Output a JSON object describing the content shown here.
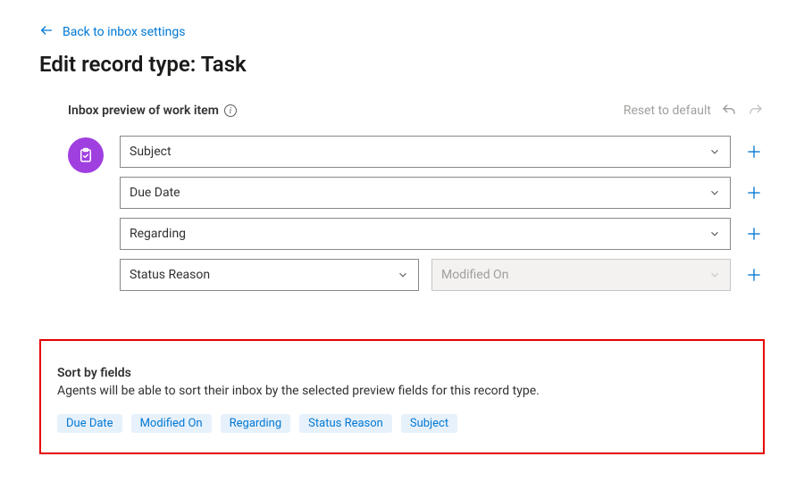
{
  "back_link": {
    "label": "Back to inbox settings"
  },
  "page_title": "Edit record type: Task",
  "preview": {
    "section_label": "Inbox preview of work item",
    "reset_label": "Reset to default",
    "rows": [
      {
        "fields": [
          {
            "label": "Subject",
            "disabled": false
          }
        ]
      },
      {
        "fields": [
          {
            "label": "Due Date",
            "disabled": false
          }
        ]
      },
      {
        "fields": [
          {
            "label": "Regarding",
            "disabled": false
          }
        ]
      },
      {
        "fields": [
          {
            "label": "Status Reason",
            "disabled": false
          },
          {
            "label": "Modified On",
            "disabled": true
          }
        ]
      }
    ]
  },
  "sort": {
    "title": "Sort by fields",
    "description": "Agents will be able to sort their inbox by the selected preview fields for this record type.",
    "chips": [
      "Due Date",
      "Modified On",
      "Regarding",
      "Status Reason",
      "Subject"
    ]
  }
}
